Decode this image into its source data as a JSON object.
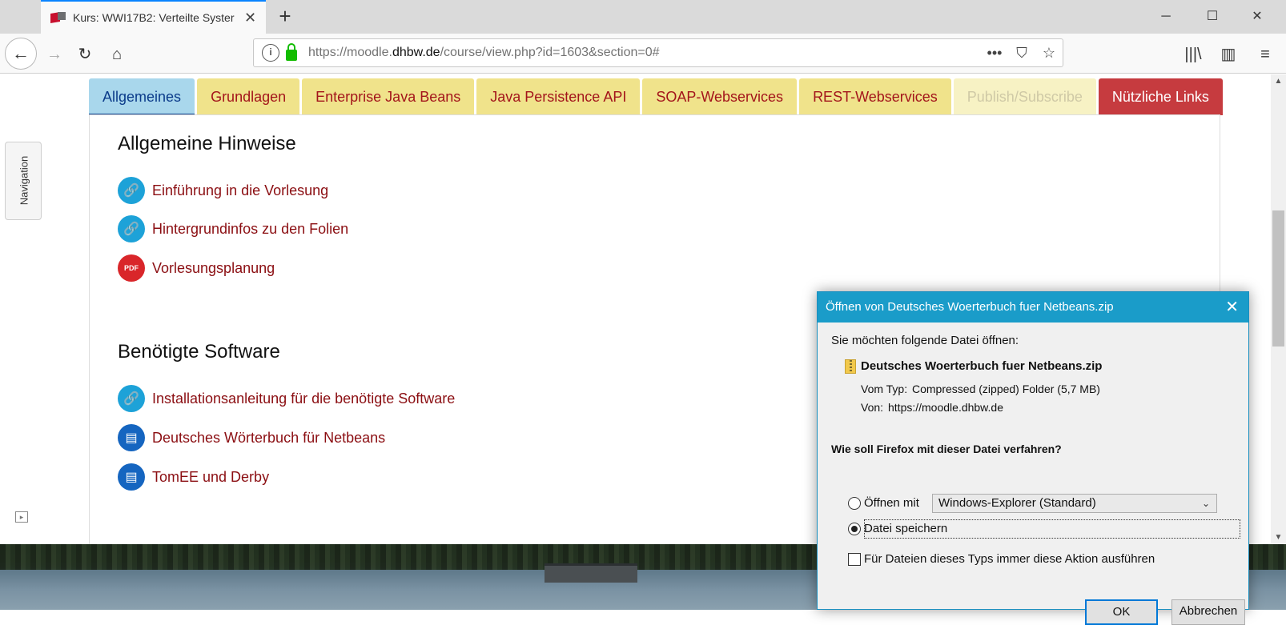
{
  "browser": {
    "tab_title": "Kurs: WWI17B2: Verteilte Syster",
    "url_prefix": "https://moodle.",
    "url_domain": "dhbw.de",
    "url_suffix": "/course/view.php?id=1603&section=0#"
  },
  "sidebar": {
    "navigation_label": "Navigation"
  },
  "course_tabs": [
    {
      "label": "Allgemeines"
    },
    {
      "label": "Grundlagen"
    },
    {
      "label": "Enterprise Java Beans"
    },
    {
      "label": "Java Persistence API"
    },
    {
      "label": "SOAP-Webservices"
    },
    {
      "label": "REST-Webservices"
    },
    {
      "label": "Publish/Subscribe"
    },
    {
      "label": "Nützliche Links"
    }
  ],
  "section1": {
    "title": "Allgemeine Hinweise",
    "links": [
      "Einführung in die Vorlesung",
      "Hintergrundinfos zu den Folien",
      "Vorlesungsplanung"
    ]
  },
  "section2": {
    "title": "Benötigte Software",
    "links": [
      "Installationsanleitung für die benötigte Software",
      "Deutsches Wörterbuch für Netbeans",
      "TomEE und Derby"
    ]
  },
  "dialog": {
    "title": "Öffnen von Deutsches Woerterbuch fuer Netbeans.zip",
    "intro": "Sie möchten folgende Datei öffnen:",
    "filename": "Deutsches Woerterbuch fuer Netbeans.zip",
    "type_label": "Vom Typ:",
    "type_value": "Compressed (zipped) Folder (5,7 MB)",
    "from_label": "Von:",
    "from_value": "https://moodle.dhbw.de",
    "question": "Wie soll Firefox mit dieser Datei verfahren?",
    "open_with_label": "Öffnen mit",
    "open_with_value": "Windows-Explorer (Standard)",
    "save_label": "Datei speichern",
    "always_label": "Für Dateien dieses Typs immer diese Aktion ausführen",
    "ok_label": "OK",
    "cancel_label": "Abbrechen"
  }
}
